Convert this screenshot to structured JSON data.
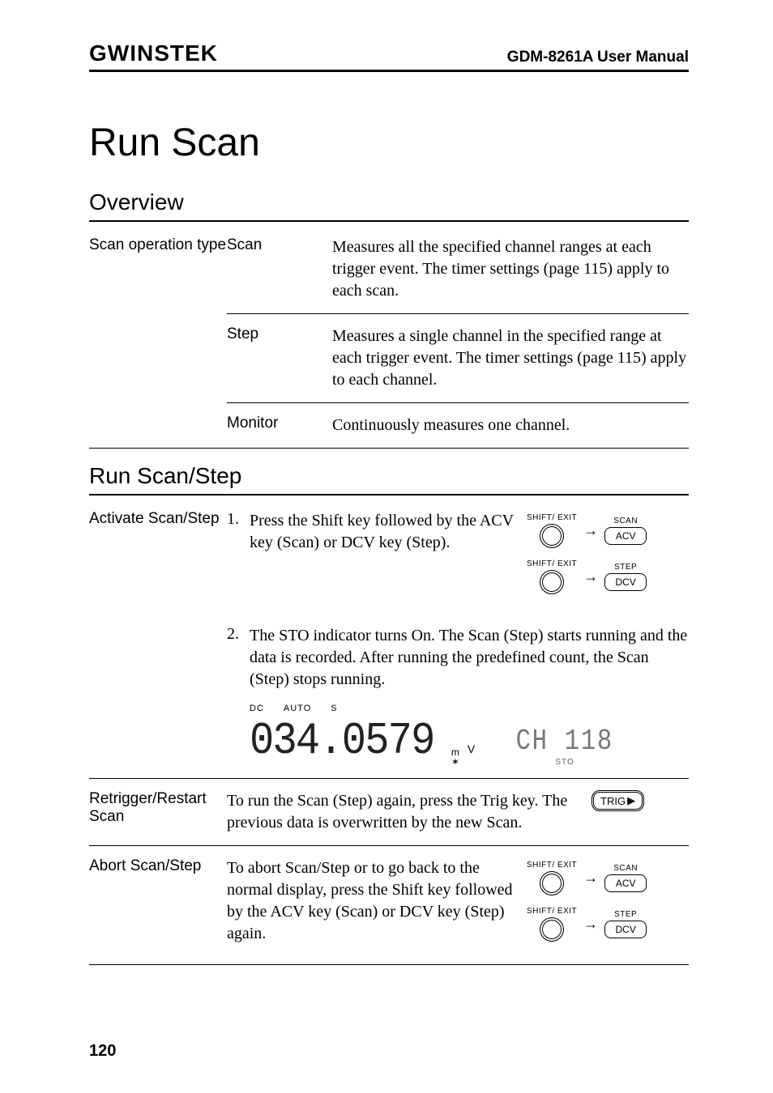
{
  "header": {
    "brand": "GWINSTEK",
    "manual": "GDM-8261A User Manual"
  },
  "title": "Run Scan",
  "overview": {
    "heading": "Overview",
    "label": "Scan operation type",
    "rows": [
      {
        "key": "Scan",
        "desc": "Measures all the specified channel ranges at each trigger event. The timer settings (page 115) apply to each scan."
      },
      {
        "key": "Step",
        "desc": "Measures a single channel in the specified range at each trigger event. The timer settings (page 115) apply to each channel."
      },
      {
        "key": "Monitor",
        "desc": "Continuously measures one channel."
      }
    ]
  },
  "runscan": {
    "heading": "Run Scan/Step",
    "activate_label": "Activate Scan/Step",
    "step1_num": "1.",
    "step1_text": "Press the Shift key followed by the ACV key (Scan) or DCV key (Step).",
    "step2_num": "2.",
    "step2_text": "The STO indicator turns On. The Scan (Step) starts running and the data is recorded. After running the predefined count, the Scan (Step) stops running.",
    "retrigger_label": "Retrigger/Restart Scan",
    "retrigger_text": "To run the Scan (Step) again, press the Trig key. The previous data is overwritten by the new Scan.",
    "abort_label": "Abort Scan/Step",
    "abort_text": "To abort Scan/Step or to go back to the normal display, press the Shift key followed by the ACV key (Scan) or DCV key (Step) again."
  },
  "keys": {
    "shift": "SHIFT/ EXIT",
    "scan": "SCAN",
    "acv": "ACV",
    "step": "STEP",
    "dcv": "DCV",
    "trig": "TRIG"
  },
  "lcd": {
    "ind_dc": "DC",
    "ind_auto": "AUTO",
    "ind_s": "S",
    "main": "034.0579",
    "unit_m": "m",
    "unit_v": "V",
    "star": "✶",
    "sec": "CH  118",
    "sto": "STO"
  },
  "page": "120"
}
